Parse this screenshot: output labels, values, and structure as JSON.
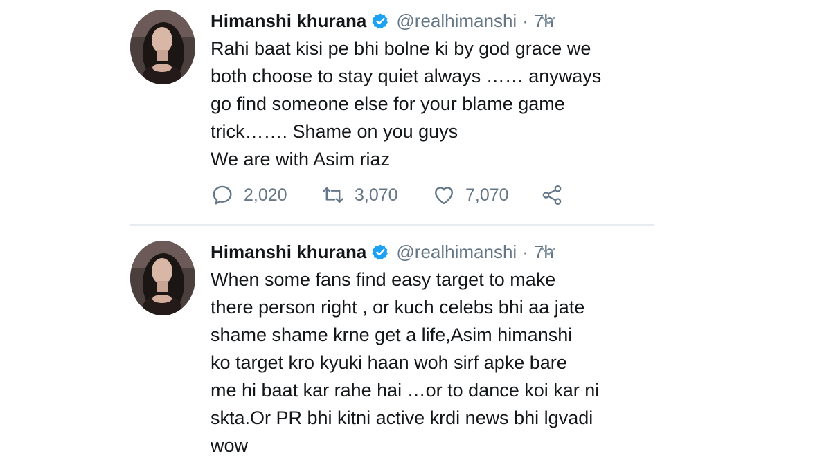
{
  "tweets": [
    {
      "author": {
        "name": "Himanshi khurana",
        "handle": "@realhimanshi",
        "verified_icon": "verified-badge-icon"
      },
      "time": "7h",
      "separator": "·",
      "text_lines": [
        "Rahi baat kisi pe bhi bolne ki by god grace we",
        "both choose to stay quiet always …… anyways",
        "go find someone else for your blame game",
        "trick……. Shame on you guys",
        "We are with Asim riaz"
      ],
      "counts": {
        "replies": "2,020",
        "retweets": "3,070",
        "likes": "7,070"
      }
    },
    {
      "author": {
        "name": "Himanshi khurana",
        "handle": "@realhimanshi",
        "verified_icon": "verified-badge-icon"
      },
      "time": "7h",
      "separator": "·",
      "text_lines": [
        "When some fans find easy target to make",
        "there person right , or kuch celebs bhi aa jate",
        "shame shame krne get a life,Asim himanshi",
        "ko target kro kyuki haan woh sirf apke bare",
        "me hi baat kar rahe hai …or to dance koi kar ni",
        "skta.Or PR bhi kitni active krdi news bhi lgvadi",
        "wow"
      ]
    }
  ],
  "icons": {
    "reply": "reply-icon",
    "retweet": "retweet-icon",
    "like": "heart-icon",
    "share": "share-icon",
    "more": "chevron-down-icon"
  },
  "colors": {
    "verified": "#1da1f2",
    "secondary_text": "#657786",
    "primary_text": "#14171a",
    "divider": "#e6ecf0"
  }
}
